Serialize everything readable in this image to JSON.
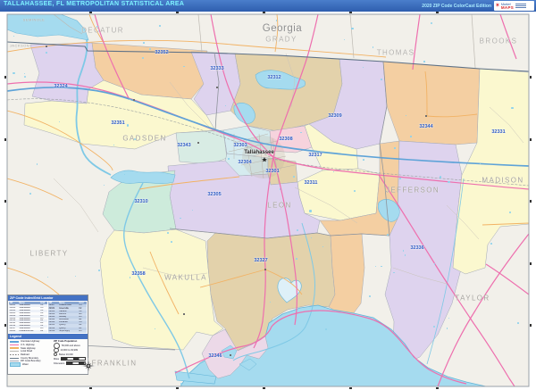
{
  "header": {
    "title": "TALLAHASSEE, FL METROPOLITAN STATISTICAL AREA",
    "edition": "2020 ZIP Code ColorCast Edition",
    "logo": {
      "market": "Market",
      "maps": "MAPS"
    }
  },
  "map": {
    "state_label": "Georgia",
    "city_label": "Tallahassee",
    "counties": [
      {
        "name": "DECATUR"
      },
      {
        "name": "GRADY"
      },
      {
        "name": "THOMAS"
      },
      {
        "name": "BROOKS"
      },
      {
        "name": "JACKSON"
      },
      {
        "name": "SEMINOLE"
      },
      {
        "name": "GADSDEN"
      },
      {
        "name": "LIBERTY"
      },
      {
        "name": "LEON"
      },
      {
        "name": "WAKULLA"
      },
      {
        "name": "FRANKLIN"
      },
      {
        "name": "JEFFERSON"
      },
      {
        "name": "MADISON"
      },
      {
        "name": "TAYLOR"
      }
    ],
    "zips": [
      {
        "code": "32324"
      },
      {
        "code": "32352"
      },
      {
        "code": "32351"
      },
      {
        "code": "32333"
      },
      {
        "code": "32312"
      },
      {
        "code": "32309"
      },
      {
        "code": "32344"
      },
      {
        "code": "32331"
      },
      {
        "code": "32343"
      },
      {
        "code": "32303"
      },
      {
        "code": "32304"
      },
      {
        "code": "32301"
      },
      {
        "code": "32308"
      },
      {
        "code": "32317"
      },
      {
        "code": "32311"
      },
      {
        "code": "32305"
      },
      {
        "code": "32310"
      },
      {
        "code": "32358"
      },
      {
        "code": "32327"
      },
      {
        "code": "32336"
      },
      {
        "code": "32346"
      }
    ]
  },
  "legend": {
    "index_title": "ZIP Code Index/Grid Locator",
    "col_headers": [
      "ZIP",
      "Name",
      "Grid"
    ],
    "left_rows": [
      [
        "32301",
        "Tallahassee",
        "C4"
      ],
      [
        "32303",
        "Tallahassee",
        "C3"
      ],
      [
        "32304",
        "Tallahassee",
        "C4"
      ],
      [
        "32305",
        "Tallahassee",
        "C4"
      ],
      [
        "32308",
        "Tallahassee",
        "D3"
      ],
      [
        "32309",
        "Tallahassee",
        "D3"
      ],
      [
        "32310",
        "Tallahassee",
        "B4"
      ],
      [
        "32311",
        "Tallahassee",
        "D4"
      ],
      [
        "32312",
        "Tallahassee",
        "C2"
      ],
      [
        "32317",
        "Tallahassee",
        "D3"
      ],
      [
        "32324",
        "Chattahoochee",
        "A2"
      ]
    ],
    "right_rows": [
      [
        "32327",
        "Crawfordville",
        "C5"
      ],
      [
        "32331",
        "Greenville",
        "F2"
      ],
      [
        "32333",
        "Havana",
        "C2"
      ],
      [
        "32336",
        "Lamont",
        "E4"
      ],
      [
        "32343",
        "Midway",
        "B3"
      ],
      [
        "32344",
        "Monticello",
        "E2"
      ],
      [
        "32346",
        "Panacea",
        "C6"
      ],
      [
        "32351",
        "Quincy",
        "B2"
      ],
      [
        "32352",
        "Quincy",
        "B1"
      ],
      [
        "32358",
        "Sopchoppy",
        "B5"
      ]
    ],
    "legend_title": "Legend",
    "roads": [
      "Interstate Highway",
      "U.S. Highway",
      "State Highway",
      "Local Road",
      "Railroad",
      "County Boundary",
      "ZIP Code Boundary",
      "Water"
    ],
    "population_title": "ZIP Code Population",
    "population_classes": [
      "50,000 and above",
      "10,000 to 49,999",
      "Below 10,000"
    ],
    "scales": [
      "Miles",
      "Kilometers"
    ]
  },
  "colors": {
    "titlebar": "#3a6fc4",
    "title_text": "#7df2ff",
    "zip_label": "#2b59c3",
    "water": "#a5dbef",
    "lavender": "#ded3ee",
    "peach": "#f4cfa2",
    "yellow": "#fbf8cf",
    "tan": "#e3d2ab",
    "mint": "#cdebdb",
    "city_cyan": "#d5ebef",
    "pink": "#f6d3dd",
    "out_of_area": "#f2f0ea",
    "us_hwy": "#ee6fae",
    "state_hwy": "#f2b264",
    "interstate": "#5ea3d8"
  }
}
